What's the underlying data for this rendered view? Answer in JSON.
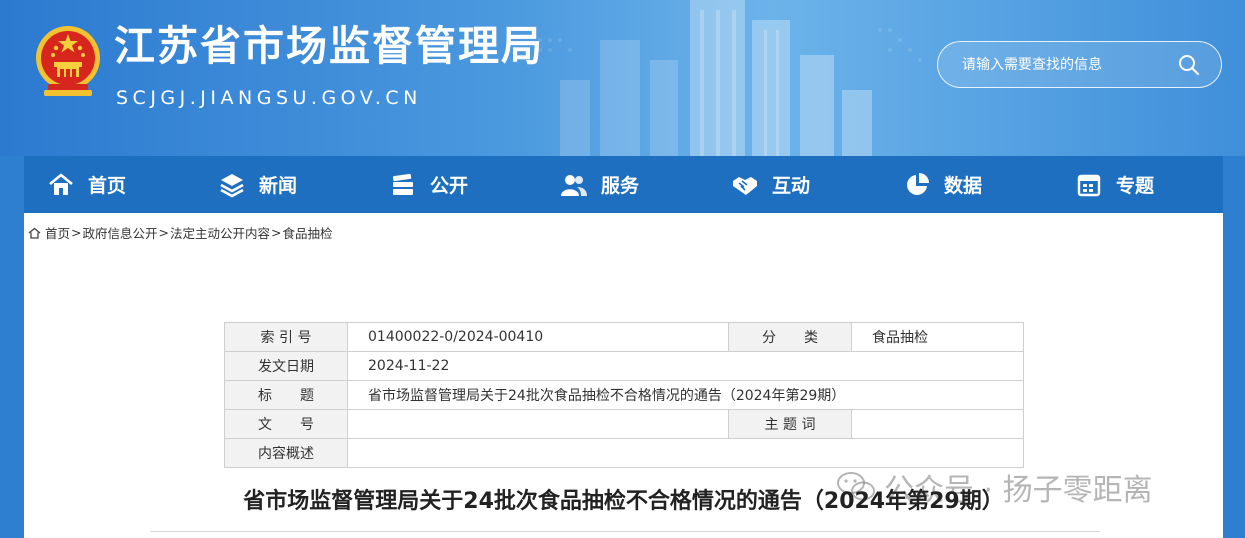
{
  "site": {
    "title": "江苏省市场监督管理局",
    "domain": "SCJGJ.JIANGSU.GOV.CN"
  },
  "search": {
    "placeholder": "请输入需要查找的信息"
  },
  "nav": {
    "items": [
      {
        "label": "首页",
        "icon": "home-icon"
      },
      {
        "label": "新闻",
        "icon": "layers-icon"
      },
      {
        "label": "公开",
        "icon": "books-icon"
      },
      {
        "label": "服务",
        "icon": "users-icon"
      },
      {
        "label": "互动",
        "icon": "handshake-icon"
      },
      {
        "label": "数据",
        "icon": "pie-chart-icon"
      },
      {
        "label": "专题",
        "icon": "calendar-icon"
      }
    ]
  },
  "breadcrumb": [
    "首页",
    "政府信息公开",
    "法定主动公开内容",
    "食品抽检"
  ],
  "meta_table": {
    "index_label": "索 引 号",
    "index_value": "01400022-0/2024-00410",
    "category_label": "分　　类",
    "category_value": "食品抽检",
    "date_label": "发文日期",
    "date_value": "2024-11-22",
    "title_label": "标　　题",
    "title_value": "省市场监督管理局关于24批次食品抽检不合格情况的通告（2024年第29期）",
    "docno_label": "文　　号",
    "docno_value": "",
    "keywords_label": "主 题 词",
    "keywords_value": "",
    "summary_label": "内容概述",
    "summary_value": ""
  },
  "article": {
    "title": "省市场监督管理局关于24批次食品抽检不合格情况的通告（2024年第29期）"
  },
  "watermark": {
    "text": "公众号 · 扬子零距离"
  },
  "colors": {
    "header_blue": "#2f7fd0",
    "nav_blue": "#1f6fc0",
    "table_label_bg": "#f2f2f2"
  }
}
